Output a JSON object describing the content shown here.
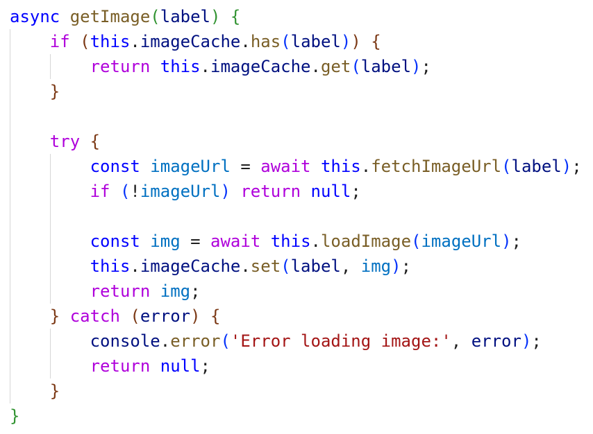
{
  "theme": {
    "background": "#ffffff",
    "keyword": "#0000ff",
    "control": "#af00db",
    "function": "#795e26",
    "variable": "#001080",
    "constant": "#0070c1",
    "string": "#a31515",
    "punctuation": "#1f1f1f",
    "bracket_level_1": "#319331",
    "bracket_level_2": "#7b3814",
    "bracket_level_3": "#0431fa",
    "indent_guide": "#d6d6d6"
  },
  "code": {
    "language": "javascript",
    "lines": [
      [
        [
          "kw",
          "async"
        ],
        [
          "p",
          " "
        ],
        [
          "fn",
          "getImage"
        ],
        [
          "b1",
          "("
        ],
        [
          "var",
          "label"
        ],
        [
          "b1",
          ")"
        ],
        [
          "p",
          " "
        ],
        [
          "b1",
          "{"
        ]
      ],
      [
        [
          "p",
          "    "
        ],
        [
          "ctrl",
          "if"
        ],
        [
          "p",
          " "
        ],
        [
          "b2",
          "("
        ],
        [
          "kw",
          "this"
        ],
        [
          "p",
          "."
        ],
        [
          "var",
          "imageCache"
        ],
        [
          "p",
          "."
        ],
        [
          "fn",
          "has"
        ],
        [
          "b3",
          "("
        ],
        [
          "var",
          "label"
        ],
        [
          "b3",
          ")"
        ],
        [
          "b2",
          ")"
        ],
        [
          "p",
          " "
        ],
        [
          "b2",
          "{"
        ]
      ],
      [
        [
          "p",
          "        "
        ],
        [
          "ctrl",
          "return"
        ],
        [
          "p",
          " "
        ],
        [
          "kw",
          "this"
        ],
        [
          "p",
          "."
        ],
        [
          "var",
          "imageCache"
        ],
        [
          "p",
          "."
        ],
        [
          "fn",
          "get"
        ],
        [
          "b3",
          "("
        ],
        [
          "var",
          "label"
        ],
        [
          "b3",
          ")"
        ],
        [
          "p",
          ";"
        ]
      ],
      [
        [
          "p",
          "    "
        ],
        [
          "b2",
          "}"
        ]
      ],
      [],
      [
        [
          "p",
          "    "
        ],
        [
          "ctrl",
          "try"
        ],
        [
          "p",
          " "
        ],
        [
          "b2",
          "{"
        ]
      ],
      [
        [
          "p",
          "        "
        ],
        [
          "kw",
          "const"
        ],
        [
          "p",
          " "
        ],
        [
          "const",
          "imageUrl"
        ],
        [
          "p",
          " = "
        ],
        [
          "ctrl",
          "await"
        ],
        [
          "p",
          " "
        ],
        [
          "kw",
          "this"
        ],
        [
          "p",
          "."
        ],
        [
          "fn",
          "fetchImageUrl"
        ],
        [
          "b3",
          "("
        ],
        [
          "var",
          "label"
        ],
        [
          "b3",
          ")"
        ],
        [
          "p",
          ";"
        ]
      ],
      [
        [
          "p",
          "        "
        ],
        [
          "ctrl",
          "if"
        ],
        [
          "p",
          " "
        ],
        [
          "b3",
          "("
        ],
        [
          "p",
          "!"
        ],
        [
          "const",
          "imageUrl"
        ],
        [
          "b3",
          ")"
        ],
        [
          "p",
          " "
        ],
        [
          "ctrl",
          "return"
        ],
        [
          "p",
          " "
        ],
        [
          "kw",
          "null"
        ],
        [
          "p",
          ";"
        ]
      ],
      [],
      [
        [
          "p",
          "        "
        ],
        [
          "kw",
          "const"
        ],
        [
          "p",
          " "
        ],
        [
          "const",
          "img"
        ],
        [
          "p",
          " = "
        ],
        [
          "ctrl",
          "await"
        ],
        [
          "p",
          " "
        ],
        [
          "kw",
          "this"
        ],
        [
          "p",
          "."
        ],
        [
          "fn",
          "loadImage"
        ],
        [
          "b3",
          "("
        ],
        [
          "const",
          "imageUrl"
        ],
        [
          "b3",
          ")"
        ],
        [
          "p",
          ";"
        ]
      ],
      [
        [
          "p",
          "        "
        ],
        [
          "kw",
          "this"
        ],
        [
          "p",
          "."
        ],
        [
          "var",
          "imageCache"
        ],
        [
          "p",
          "."
        ],
        [
          "fn",
          "set"
        ],
        [
          "b3",
          "("
        ],
        [
          "var",
          "label"
        ],
        [
          "p",
          ", "
        ],
        [
          "const",
          "img"
        ],
        [
          "b3",
          ")"
        ],
        [
          "p",
          ";"
        ]
      ],
      [
        [
          "p",
          "        "
        ],
        [
          "ctrl",
          "return"
        ],
        [
          "p",
          " "
        ],
        [
          "const",
          "img"
        ],
        [
          "p",
          ";"
        ]
      ],
      [
        [
          "p",
          "    "
        ],
        [
          "b2",
          "}"
        ],
        [
          "p",
          " "
        ],
        [
          "ctrl",
          "catch"
        ],
        [
          "p",
          " "
        ],
        [
          "b2",
          "("
        ],
        [
          "var",
          "error"
        ],
        [
          "b2",
          ")"
        ],
        [
          "p",
          " "
        ],
        [
          "b2",
          "{"
        ]
      ],
      [
        [
          "p",
          "        "
        ],
        [
          "var",
          "console"
        ],
        [
          "p",
          "."
        ],
        [
          "fn",
          "error"
        ],
        [
          "b3",
          "("
        ],
        [
          "str",
          "'Error loading image:'"
        ],
        [
          "p",
          ", "
        ],
        [
          "var",
          "error"
        ],
        [
          "b3",
          ")"
        ],
        [
          "p",
          ";"
        ]
      ],
      [
        [
          "p",
          "        "
        ],
        [
          "ctrl",
          "return"
        ],
        [
          "p",
          " "
        ],
        [
          "kw",
          "null"
        ],
        [
          "p",
          ";"
        ]
      ],
      [
        [
          "p",
          "    "
        ],
        [
          "b2",
          "}"
        ]
      ],
      [
        [
          "b1",
          "}"
        ]
      ]
    ]
  }
}
